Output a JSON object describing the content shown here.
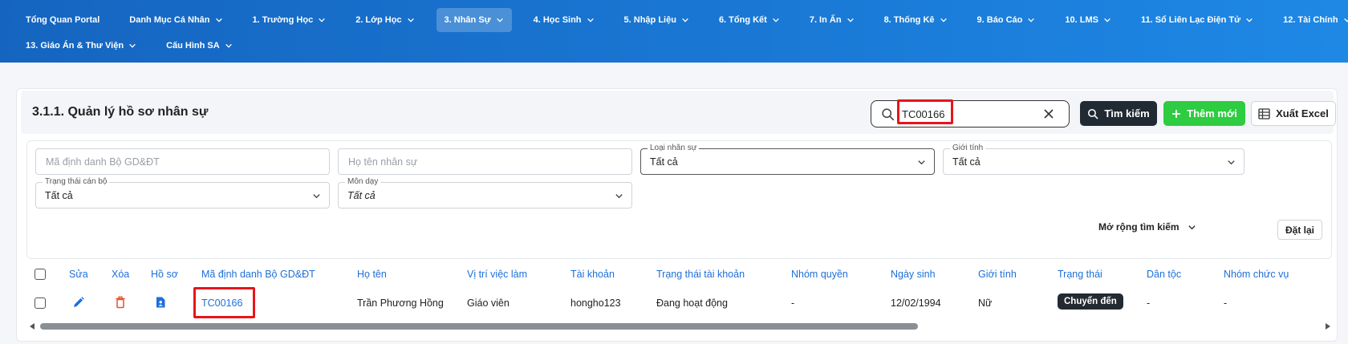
{
  "nav": {
    "row1": [
      {
        "label": "Tổng Quan Portal",
        "chevron": false,
        "active": false
      },
      {
        "label": "Danh Mục Cá Nhân",
        "chevron": true,
        "active": false
      },
      {
        "label": "1. Trường Học",
        "chevron": true,
        "active": false
      },
      {
        "label": "2. Lớp Học",
        "chevron": true,
        "active": false
      },
      {
        "label": "3. Nhân Sự",
        "chevron": true,
        "active": true
      },
      {
        "label": "4. Học Sinh",
        "chevron": true,
        "active": false
      },
      {
        "label": "5. Nhập Liệu",
        "chevron": true,
        "active": false
      },
      {
        "label": "6. Tổng Kết",
        "chevron": true,
        "active": false
      },
      {
        "label": "7. In Ấn",
        "chevron": true,
        "active": false
      },
      {
        "label": "8. Thống Kê",
        "chevron": true,
        "active": false
      },
      {
        "label": "9. Báo Cáo",
        "chevron": true,
        "active": false
      },
      {
        "label": "10. LMS",
        "chevron": true,
        "active": false
      },
      {
        "label": "11. Sổ Liên Lạc Điện Tử",
        "chevron": true,
        "active": false
      },
      {
        "label": "12. Tài Chính",
        "chevron": true,
        "active": false
      }
    ],
    "row2": [
      {
        "label": "13. Giáo Án & Thư Viện",
        "chevron": true,
        "active": false
      },
      {
        "label": "Cấu Hình SA",
        "chevron": true,
        "active": false
      }
    ]
  },
  "page": {
    "title": "3.1.1. Quản lý hồ sơ nhân sự"
  },
  "search": {
    "value": "TC00166",
    "icon": "search-icon",
    "clear_icon": "close-icon"
  },
  "toolbar": {
    "search_label": "Tìm kiếm",
    "add_label": "Thêm mới",
    "export_label": "Xuất Excel"
  },
  "filters": {
    "ma_dinh_danh": {
      "placeholder": "Mã định danh Bộ GD&ĐT"
    },
    "ho_ten": {
      "placeholder": "Họ tên nhân sự"
    },
    "loai_nhan_su": {
      "label": "Loại nhân sự",
      "value": "Tất cả"
    },
    "gioi_tinh": {
      "label": "Giới tính",
      "value": "Tất cả"
    },
    "trang_thai_can_bo": {
      "label": "Trạng thái cán bộ",
      "value": "Tất cả"
    },
    "mon_day": {
      "label": "Môn dạy",
      "value": "Tất cả"
    },
    "expand_label": "Mở rộng tìm kiếm",
    "reset_label": "Đặt lại"
  },
  "table": {
    "headers": {
      "sua": "Sửa",
      "xoa": "Xóa",
      "ho_so": "Hồ sơ",
      "ma_dinh_danh": "Mã định danh Bộ GD&ĐT",
      "ho_ten": "Họ tên",
      "vi_tri": "Vị trí việc làm",
      "tai_khoan": "Tài khoản",
      "trang_thai_tk": "Trạng thái tài khoản",
      "nhom_quyen": "Nhóm quyền",
      "ngay_sinh": "Ngày sinh",
      "gioi_tinh": "Giới tính",
      "trang_thai": "Trạng thái",
      "dan_toc": "Dân tộc",
      "nhom_chuc_vu": "Nhóm chức vụ"
    },
    "rows": [
      {
        "ma_dinh_danh": "TC00166",
        "ho_ten": "Trần Phương Hồng",
        "vi_tri": "Giáo viên",
        "tai_khoan": "hongho123",
        "trang_thai_tk": "Đang hoạt động",
        "nhom_quyen": "-",
        "ngay_sinh": "12/02/1994",
        "gioi_tinh": "Nữ",
        "trang_thai": "Chuyển đến",
        "dan_toc": "-",
        "nhom_chuc_vu": "-"
      }
    ]
  },
  "colors": {
    "nav_blue": "#1976d2",
    "link_blue": "#1e6fd9",
    "green": "#2ecc40",
    "dark": "#212a33",
    "highlight_red": "#e8141c",
    "delete_red": "#e8502a"
  }
}
